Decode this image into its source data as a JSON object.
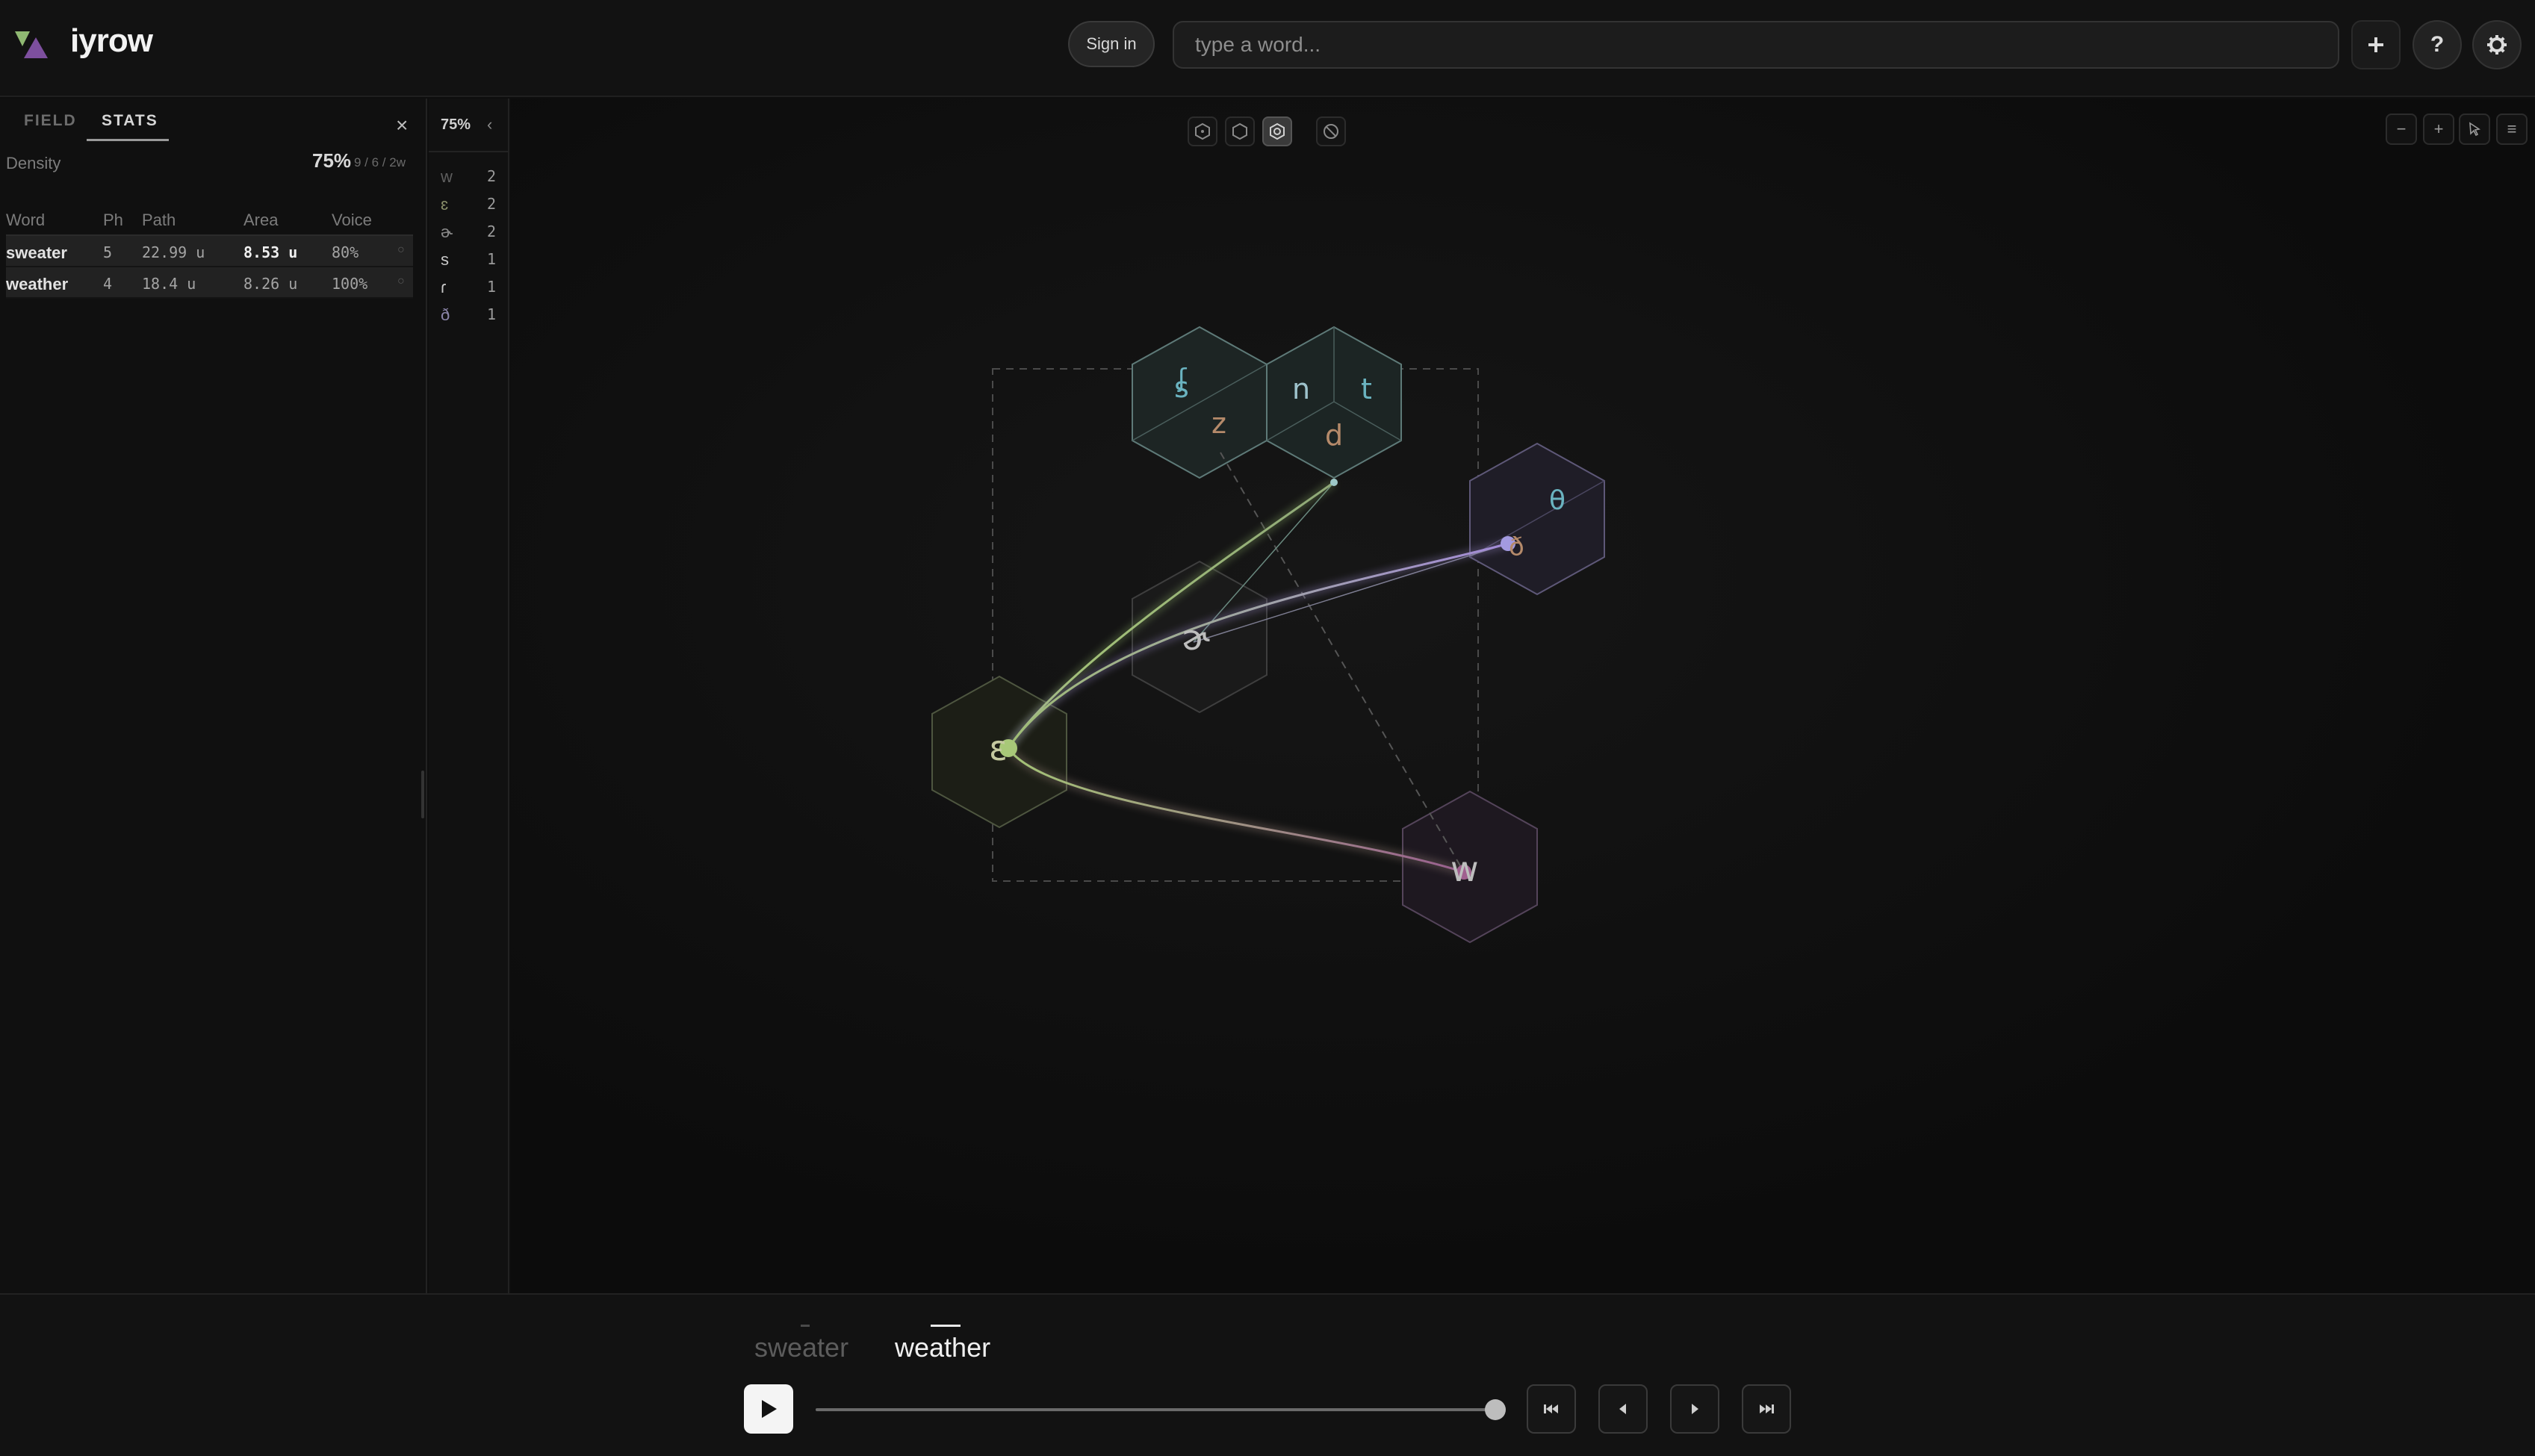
{
  "app": {
    "brand": "iyrow"
  },
  "header": {
    "signin_label": "Sign in",
    "search_placeholder": "type a word...",
    "add_icon": "plus-icon",
    "help_label": "?",
    "settings_icon": "gear-icon"
  },
  "leftpanel": {
    "tabs": [
      "FIELD",
      "STATS"
    ],
    "active_tab": "STATS",
    "density_label": "Density",
    "density_value": "75%",
    "density_sub": "9 / 6 / 2w",
    "columns": [
      "Word",
      "Ph",
      "Path",
      "Area",
      "Voice"
    ],
    "rows": [
      {
        "word": "sweater",
        "ph": "5",
        "path": "22.99 u",
        "area": "8.53 u",
        "voice": "80%"
      },
      {
        "word": "weather",
        "ph": "4",
        "path": "18.4 u",
        "area": "8.26 u",
        "voice": "100%"
      }
    ],
    "close_label": "×"
  },
  "phoneme_counts": {
    "percent": "75%",
    "collapse_label": "‹",
    "items": [
      {
        "sym": "w",
        "count": "2",
        "color": "#5e5e5e"
      },
      {
        "sym": "ɛ",
        "count": "2",
        "color": "#8a8f6a"
      },
      {
        "sym": "ɚ",
        "count": "2",
        "color": "#8a8a8a"
      },
      {
        "sym": "s",
        "count": "1",
        "color": "#c8c8c8"
      },
      {
        "sym": "ɾ",
        "count": "1",
        "color": "#c8c8c8"
      },
      {
        "sym": "ð",
        "count": "1",
        "color": "#8a84a8"
      }
    ]
  },
  "canvas": {
    "tools": [
      "hex-outline-icon",
      "hex-icon",
      "hex-dot-icon",
      "no-icon"
    ],
    "active_tool": 2,
    "right_tools": [
      "−",
      "+",
      "cursor-icon",
      "≡"
    ],
    "cells": [
      {
        "id": "sz",
        "labels": [
          {
            "t": "ʃ",
            "c": "#6ab3c0"
          },
          {
            "t": "s",
            "c": "#6ab3c0"
          },
          {
            "t": "z",
            "c": "#b58a6a"
          }
        ]
      },
      {
        "id": "ntd",
        "labels": [
          {
            "t": "n",
            "c": "#9ec3cc"
          },
          {
            "t": "t",
            "c": "#6ab3c0"
          },
          {
            "t": "d",
            "c": "#b58a6a"
          }
        ]
      },
      {
        "id": "theta",
        "labels": [
          {
            "t": "θ",
            "c": "#6ab3c0"
          },
          {
            "t": "ð",
            "c": "#b58a6a"
          }
        ]
      },
      {
        "id": "er",
        "labels": [
          {
            "t": "ɚ",
            "c": "#bdbdbd"
          }
        ]
      },
      {
        "id": "eps",
        "labels": [
          {
            "t": "ɛ",
            "c": "#c4c9a0"
          }
        ]
      },
      {
        "id": "w",
        "labels": [
          {
            "t": "w",
            "c": "#bdbdbd"
          }
        ]
      }
    ]
  },
  "footer": {
    "words": [
      "sweater",
      "weather"
    ],
    "active_word": 1,
    "progress": 1.0
  }
}
